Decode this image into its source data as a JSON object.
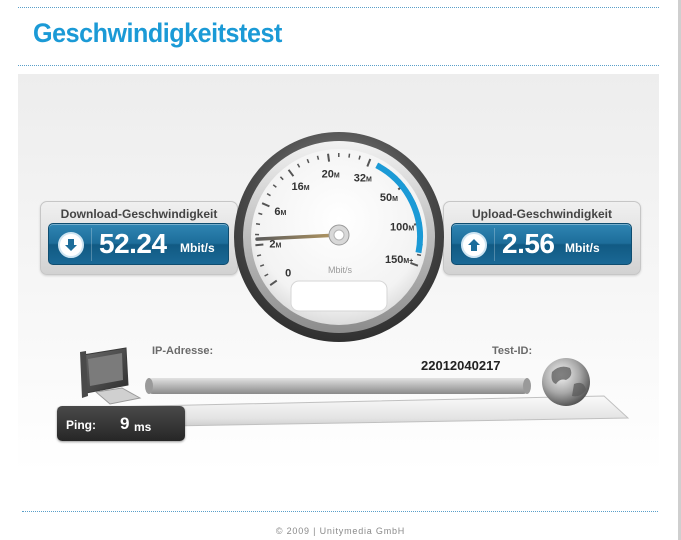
{
  "header": {
    "title": "Geschwindigkeitstest"
  },
  "download": {
    "label": "Download-Geschwindigkeit",
    "value": "52.24",
    "unit": "Mbit/s",
    "icon": "arrow-down-icon"
  },
  "upload": {
    "label": "Upload-Geschwindigkeit",
    "value": "2.56",
    "unit": "Mbit/s",
    "icon": "arrow-up-icon"
  },
  "gauge": {
    "unit_label": "Mbit/s",
    "scale": [
      {
        "num": "0",
        "suffix": ""
      },
      {
        "num": "2",
        "suffix": "M"
      },
      {
        "num": "6",
        "suffix": "M"
      },
      {
        "num": "16",
        "suffix": "M"
      },
      {
        "num": "20",
        "suffix": "M"
      },
      {
        "num": "32",
        "suffix": "M"
      },
      {
        "num": "50",
        "suffix": "M"
      },
      {
        "num": "100",
        "suffix": "M"
      },
      {
        "num": "150",
        "suffix": "M+"
      }
    ],
    "needle_value_mbit": 2.56,
    "accent_color": "#1b9ad6"
  },
  "connection": {
    "ip_label": "IP-Adresse:",
    "ip_value": "",
    "test_id_label": "Test-ID:",
    "test_id_value": "22012040217"
  },
  "ping": {
    "label": "Ping:",
    "value": "9",
    "unit": "ms"
  },
  "footer": {
    "text": "© 2009 | Unitymedia GmbH"
  },
  "colors": {
    "brand": "#1b9ad6",
    "panel_blue": "#1d6d9a",
    "ping_bg": "#333333"
  }
}
